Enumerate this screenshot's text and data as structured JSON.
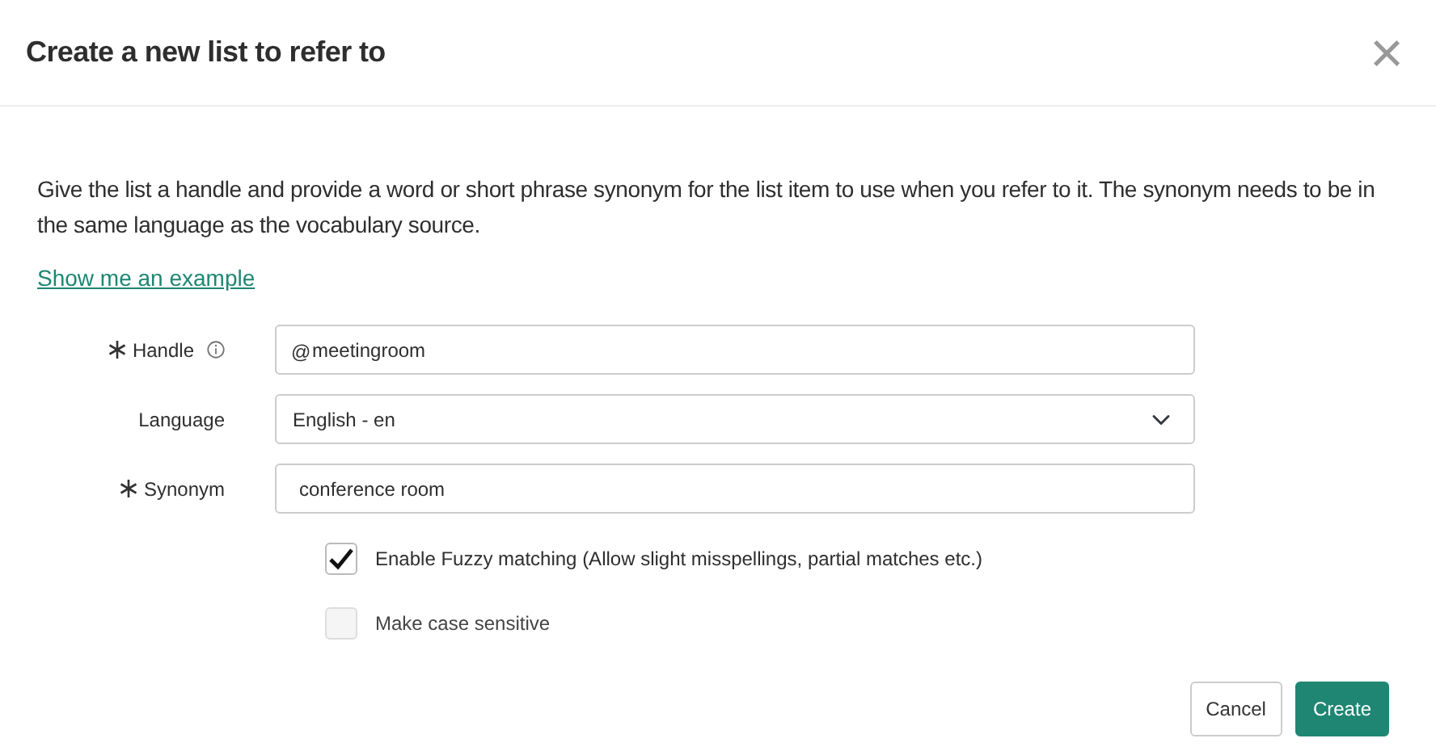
{
  "dialog": {
    "title": "Create a new list to refer to",
    "close": "×"
  },
  "description": "Give the list a handle and provide a word or short phrase synonym for the list item to use when you refer to it. The synonym needs to be in the same language as the vocabulary source.",
  "example_link": "Show me an example",
  "fields": [
    {
      "kind": "prefixed",
      "label": "Handle",
      "required": true,
      "info": true,
      "prefix": "@",
      "value": "meetingroom"
    },
    {
      "kind": "select",
      "label": "Language",
      "required": false,
      "info": false,
      "value": "English - en"
    },
    {
      "kind": "text",
      "label": "Synonym",
      "required": true,
      "info": false,
      "value": "conference room"
    }
  ],
  "options": [
    {
      "label": "Enable Fuzzy matching (Allow slight misspellings, partial matches etc.)",
      "checked": true,
      "disabled": false
    },
    {
      "label": "Make case sensitive",
      "checked": false,
      "disabled": true
    }
  ],
  "buttons": [
    {
      "label": "Cancel",
      "kind": "secondary"
    },
    {
      "label": "Create",
      "kind": "primary"
    }
  ]
}
